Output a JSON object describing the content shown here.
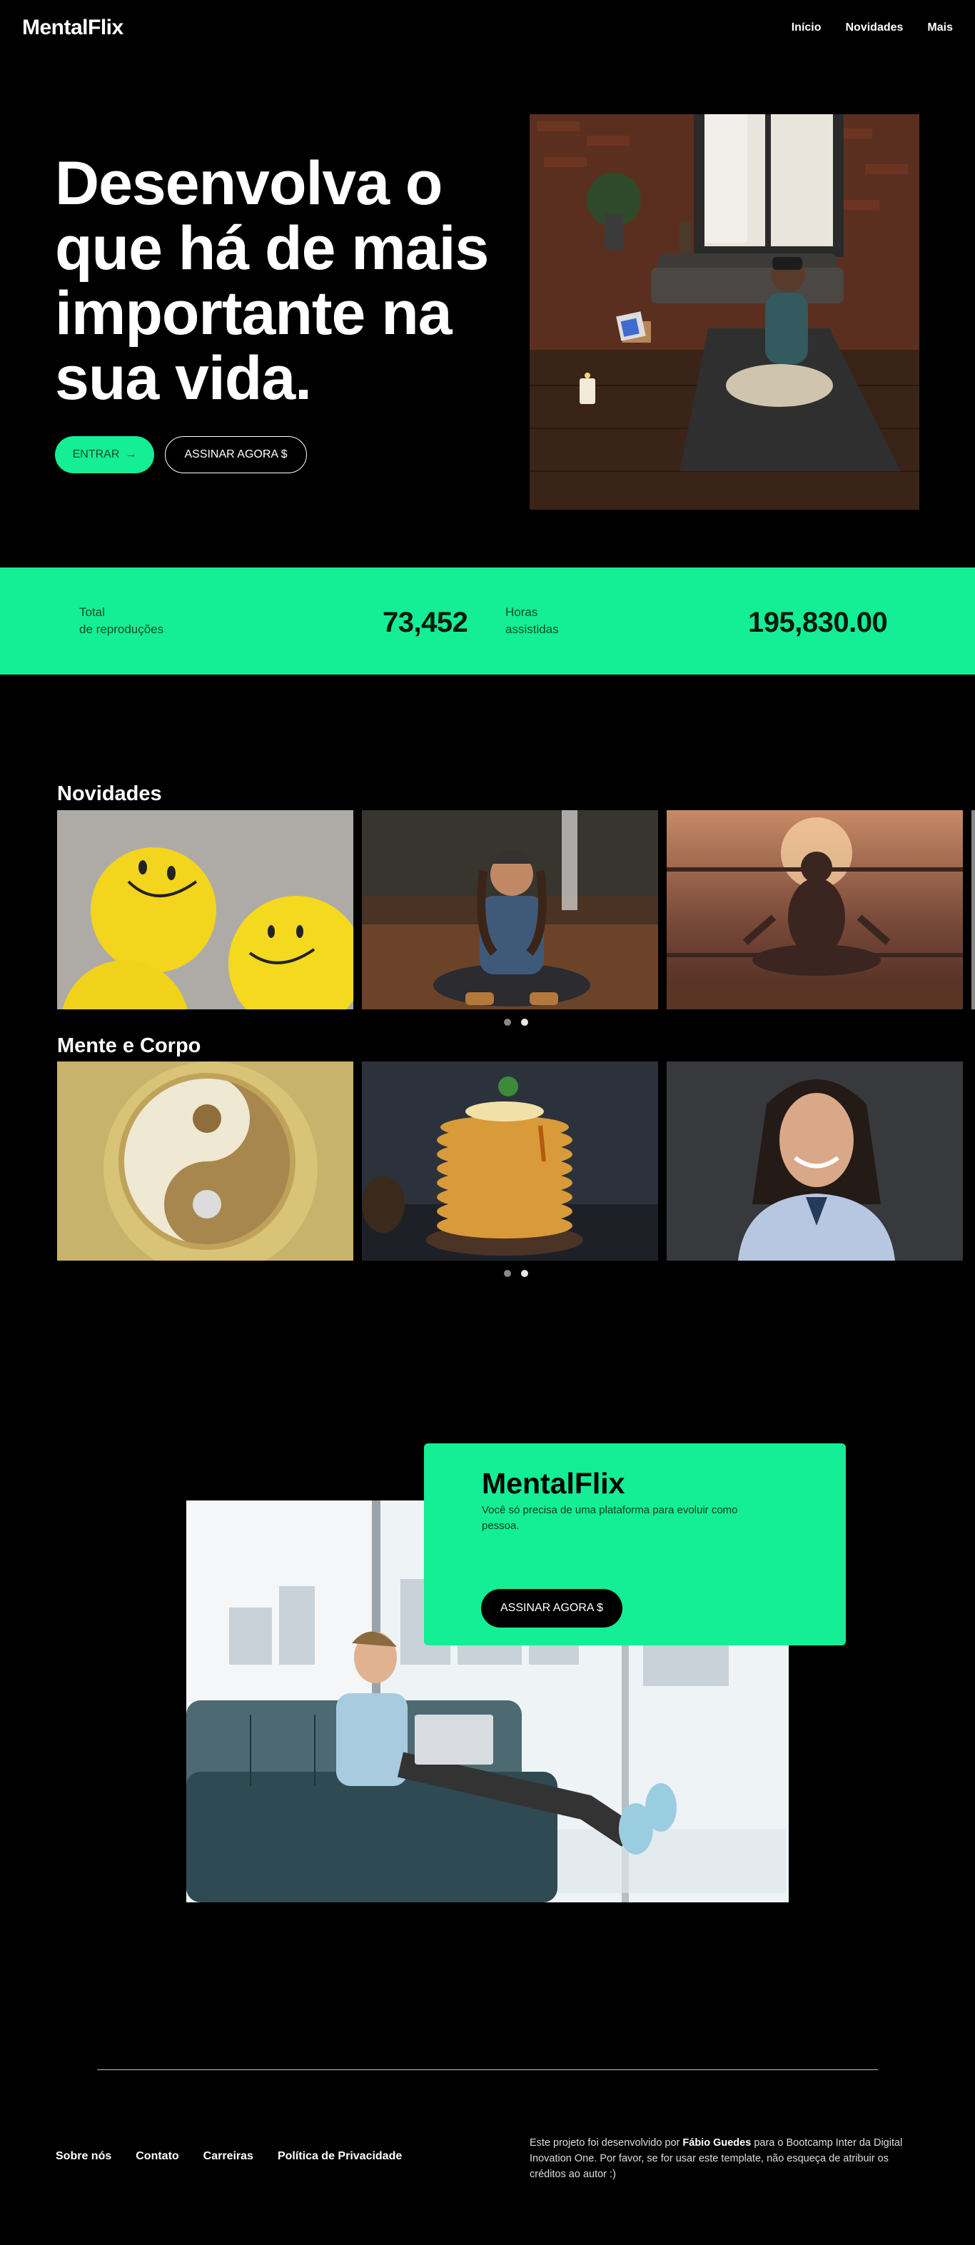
{
  "nav": {
    "logo": "MentalFlix",
    "links": [
      "Início",
      "Novidades",
      "Mais"
    ]
  },
  "hero": {
    "title": "Desenvolva o que há de mais importante na sua vida.",
    "enter_label": "ENTRAR",
    "enter_arrow": "→",
    "subscribe_label": "ASSINAR AGORA $"
  },
  "stats": {
    "plays_label_1": "Total",
    "plays_label_2": "de reproduções",
    "plays_value": "73,452",
    "hours_label_1": "Horas",
    "hours_label_2": "assistidas",
    "hours_value": "195,830.00"
  },
  "sections": {
    "news_title": "Novidades",
    "body_title": "Mente e Corpo"
  },
  "promo": {
    "title": "MentalFlix",
    "text": "Você só precisa de uma plataforma para evoluir como pessoa.",
    "button": "ASSINAR AGORA $"
  },
  "footer": {
    "links": [
      "Sobre nós",
      "Contato",
      "Carreiras",
      "Política de Privacidade"
    ],
    "text_before": "Este projeto foi desenvolvido por ",
    "author": "Fábio Guedes",
    "text_after": " para o Bootcamp Inter da Digital Inovation One. Por favor, se for usar este template, não esqueça de atribuir os créditos ao autor :)"
  },
  "colors": {
    "accent": "#14ee94",
    "background": "#000000",
    "text": "#ffffff"
  }
}
